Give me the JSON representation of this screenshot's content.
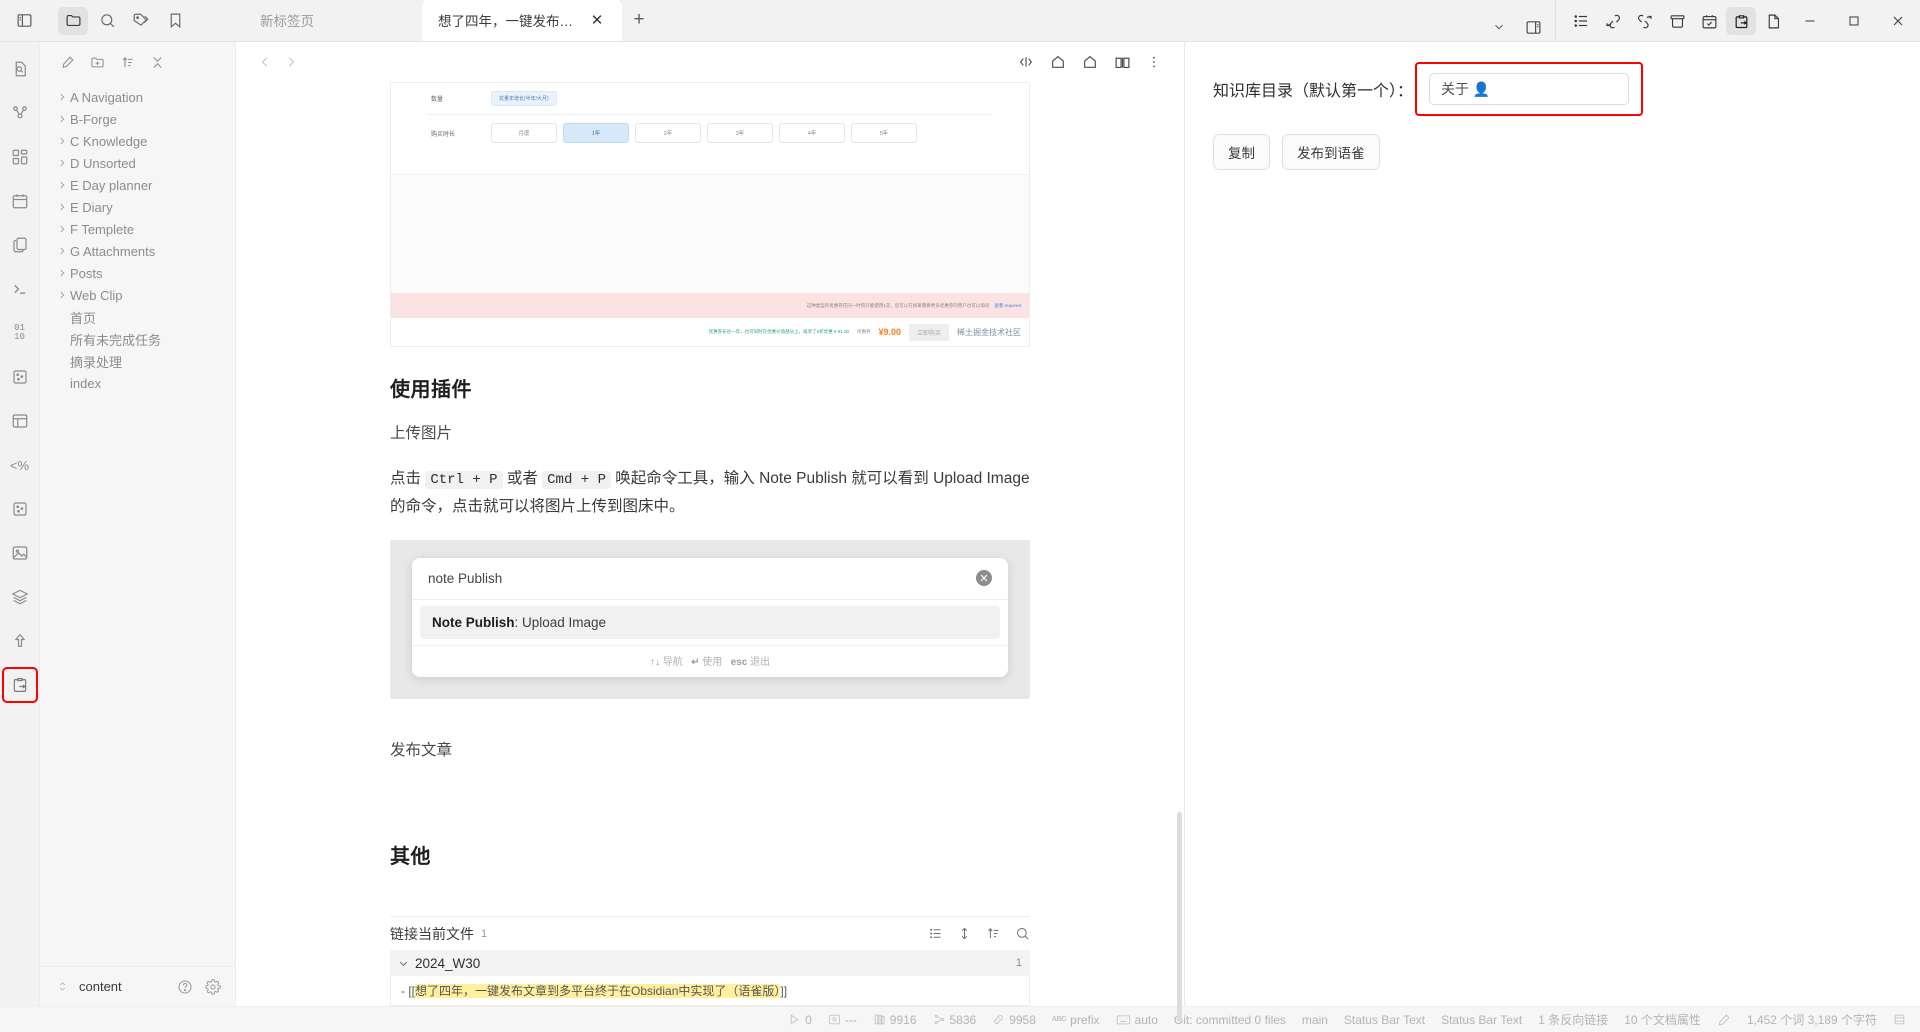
{
  "window": {
    "minimize": "–",
    "maximize": "□",
    "close": "✕"
  },
  "topbar": {
    "sidebar_toggle_icon": "sidebar-toggle-icon",
    "ribbon": [
      {
        "name": "folder-icon",
        "label": "文件",
        "active": true
      },
      {
        "name": "search-icon",
        "label": "搜索",
        "active": false
      },
      {
        "name": "tags-icon",
        "label": "标签",
        "active": false
      },
      {
        "name": "bookmark-icon",
        "label": "书签",
        "active": false
      }
    ],
    "tabs": [
      {
        "label": "新标签页",
        "active": false,
        "closable": false
      },
      {
        "label": "想了四年，一键发布文章...",
        "active": true,
        "closable": true
      }
    ],
    "new_tab_label": "+",
    "tab_close_label": "✕",
    "chevron_down": "⌄",
    "right_tools": [
      {
        "name": "list-icon"
      },
      {
        "name": "link-in-icon"
      },
      {
        "name": "link-out-icon"
      },
      {
        "name": "archive-icon"
      },
      {
        "name": "calendar-check-icon"
      },
      {
        "name": "clipboard-export-icon",
        "active": true
      },
      {
        "name": "file-icon"
      }
    ]
  },
  "rail": {
    "icons": [
      "file-search-icon",
      "graph-icon",
      "canvas-grid-icon",
      "calendar-icon",
      "copy-files-icon",
      "terminal-icon",
      "binary-icon",
      "dice-icon",
      "layout-icon",
      "percent-code-icon",
      "dice-2-icon",
      "image-icon",
      "layers-icon",
      "upload-icon",
      "clipboard-export-icon"
    ],
    "highlighted_index": 14
  },
  "explorer": {
    "toolbar": [
      {
        "name": "new-note-icon"
      },
      {
        "name": "new-folder-icon"
      },
      {
        "name": "sort-icon"
      },
      {
        "name": "collapse-all-icon"
      }
    ],
    "tree": [
      {
        "label": "A Navigation",
        "type": "folder"
      },
      {
        "label": "B-Forge",
        "type": "folder"
      },
      {
        "label": "C Knowledge",
        "type": "folder"
      },
      {
        "label": "D Unsorted",
        "type": "folder"
      },
      {
        "label": "E Day planner",
        "type": "folder"
      },
      {
        "label": "E Diary",
        "type": "folder"
      },
      {
        "label": "F Templete",
        "type": "folder"
      },
      {
        "label": "G Attachments",
        "type": "folder"
      },
      {
        "label": "Posts",
        "type": "folder"
      },
      {
        "label": "Web Clip",
        "type": "folder"
      },
      {
        "label": "首页",
        "type": "file"
      },
      {
        "label": "所有未完成任务",
        "type": "file"
      },
      {
        "label": "摘录处理",
        "type": "file"
      },
      {
        "label": "index",
        "type": "file"
      }
    ],
    "footer": {
      "vault_name": "content",
      "help_icon": "help-icon",
      "settings_icon": "gear-icon",
      "switch_icon": "vault-switch-icon"
    }
  },
  "note": {
    "nav_back": "‹",
    "nav_forward": "›",
    "header_icons": [
      {
        "name": "source-code-icon"
      },
      {
        "name": "home-icon"
      },
      {
        "name": "home-alt-icon"
      },
      {
        "name": "book-open-icon"
      },
      {
        "name": "more-vertical-icon"
      }
    ],
    "embedded_screenshot": {
      "row1_label": "数量",
      "row1_pill": "抗量年增长(半年/大月)",
      "row2_label": "购买时长",
      "options": [
        "月度",
        "1年",
        "2年",
        "3年",
        "4年",
        "5年"
      ],
      "selected_option_index": 1,
      "notice": "这种类型的优惠券在同一时刻只能使用1次，您可以在如果需要更多优惠券的用户也可以询问",
      "notice_link": "查看 required",
      "price_label": "优惠券",
      "price": "¥9.00",
      "green_note": "优惠券长达一年，也可同时在优惠价值部分上，再享了5折优惠 € ¥1.00",
      "buy_button": "立即购买",
      "brand": "稀土掘金技术社区"
    },
    "headings": {
      "use_plugin": "使用插件",
      "other": "其他"
    },
    "sub_upload": "上传图片",
    "paragraph_parts": {
      "p1": "点击 ",
      "kbd1": "Ctrl + P",
      "p2": " 或者 ",
      "kbd2": "Cmd + P",
      "p3": " 唤起命令工具，输入 Note Publish 就可以看到 Upload Image 的命令，点击就可以将图片上传到图床中。"
    },
    "publish_article": "发布文章",
    "command_palette": {
      "query": "note Publish",
      "clear_icon": "clear-icon",
      "result_bold": "Note Publish",
      "result_rest": ": Upload Image",
      "hint_nav_keys": "↑↓",
      "hint_nav": "导航",
      "hint_enter_key": "↵",
      "hint_enter": "使用",
      "hint_esc_key": "esc",
      "hint_esc": "退出"
    },
    "backlinks": {
      "title": "链接当前文件",
      "count": "1",
      "tools": [
        {
          "name": "collapse-results-icon"
        },
        {
          "name": "expand-results-icon"
        },
        {
          "name": "sort-order-icon"
        },
        {
          "name": "search-backlinks-icon"
        }
      ],
      "group_name": "2024_W30",
      "group_count": "1",
      "group_chevron": "⌄",
      "item_prefix": "- [[",
      "item_text": "想了四年，一键发布文章到多平台终于在Obsidian中实现了（语雀版）",
      "item_suffix": "]]"
    }
  },
  "right_panel": {
    "label": "知识库目录（默认第一个）：",
    "input_value": "关于 👤",
    "input_placeholder": "",
    "buttons": [
      {
        "label": "复制",
        "name": "copy-button"
      },
      {
        "label": "发布到语雀",
        "name": "publish-to-yuque-button"
      }
    ]
  },
  "statusbar": {
    "items": [
      {
        "icon": "play-icon",
        "text": "0"
      },
      {
        "icon": "image-status-icon",
        "text": "---"
      },
      {
        "icon": "book-status-icon",
        "text": "9916"
      },
      {
        "icon": "graph-status-icon",
        "text": "5836"
      },
      {
        "icon": "link-status-icon",
        "text": "9958"
      },
      {
        "icon": "abc-icon",
        "text": "prefix"
      },
      {
        "icon": "keyboard-icon",
        "text": "auto"
      },
      {
        "icon": "",
        "text": "Git: committed 0 files"
      },
      {
        "icon": "",
        "text": "main"
      },
      {
        "icon": "",
        "text": "Status Bar Text"
      },
      {
        "icon": "",
        "text": "Status Bar Text"
      },
      {
        "icon": "",
        "text": "1 条反向链接"
      },
      {
        "icon": "",
        "text": "10 个文档属性"
      },
      {
        "icon": "pencil-icon",
        "text": ""
      },
      {
        "icon": "",
        "text": "1,452 个词  3,189 个字符"
      },
      {
        "icon": "layout-status-icon",
        "text": ""
      }
    ]
  },
  "colors": {
    "accent_red": "#fe0000",
    "highlight_yellow": "#ffef9e",
    "chrome_bg": "#f2f2f2",
    "page_bg": "#ffffff"
  }
}
